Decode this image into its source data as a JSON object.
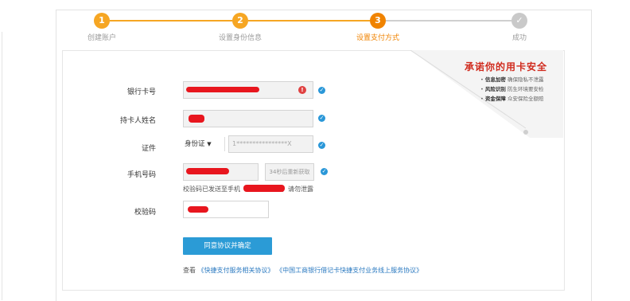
{
  "steps": [
    {
      "number": "1",
      "label": "创建账户"
    },
    {
      "number": "2",
      "label": "设置身份信息"
    },
    {
      "number": "3",
      "label": "设置支付方式"
    },
    {
      "number": "✓",
      "label": "成功"
    }
  ],
  "promo": {
    "title": "承诺你的用卡安全",
    "items": [
      {
        "bold": "信息加密",
        "text": "确保隐私不泄露"
      },
      {
        "bold": "风险识别",
        "text": "防生环境要安检"
      },
      {
        "bold": "资金保障",
        "text": "众安保险全额赔"
      }
    ]
  },
  "form": {
    "card_label": "银行卡号",
    "name_label": "持卡人姓名",
    "id_label": "证件",
    "id_type": "身份证",
    "id_value": "1****************X",
    "phone_label": "手机号码",
    "sms_button": "34秒后重新获取",
    "sms_hint_prefix": "校验码已发送至手机",
    "sms_hint_suffix": "，请勿泄露",
    "code_label": "校验码",
    "submit": "同意协议并确定"
  },
  "agreement": {
    "prefix": "查看",
    "link1": "《快捷支付服务相关协议》",
    "link2": "《中国工商银行借记卡快捷支付业务线上服务协议》"
  },
  "colors": {
    "accent": "#f6a623",
    "active": "#f08300",
    "primary": "#2b9bd6",
    "redact": "#e8161e"
  }
}
